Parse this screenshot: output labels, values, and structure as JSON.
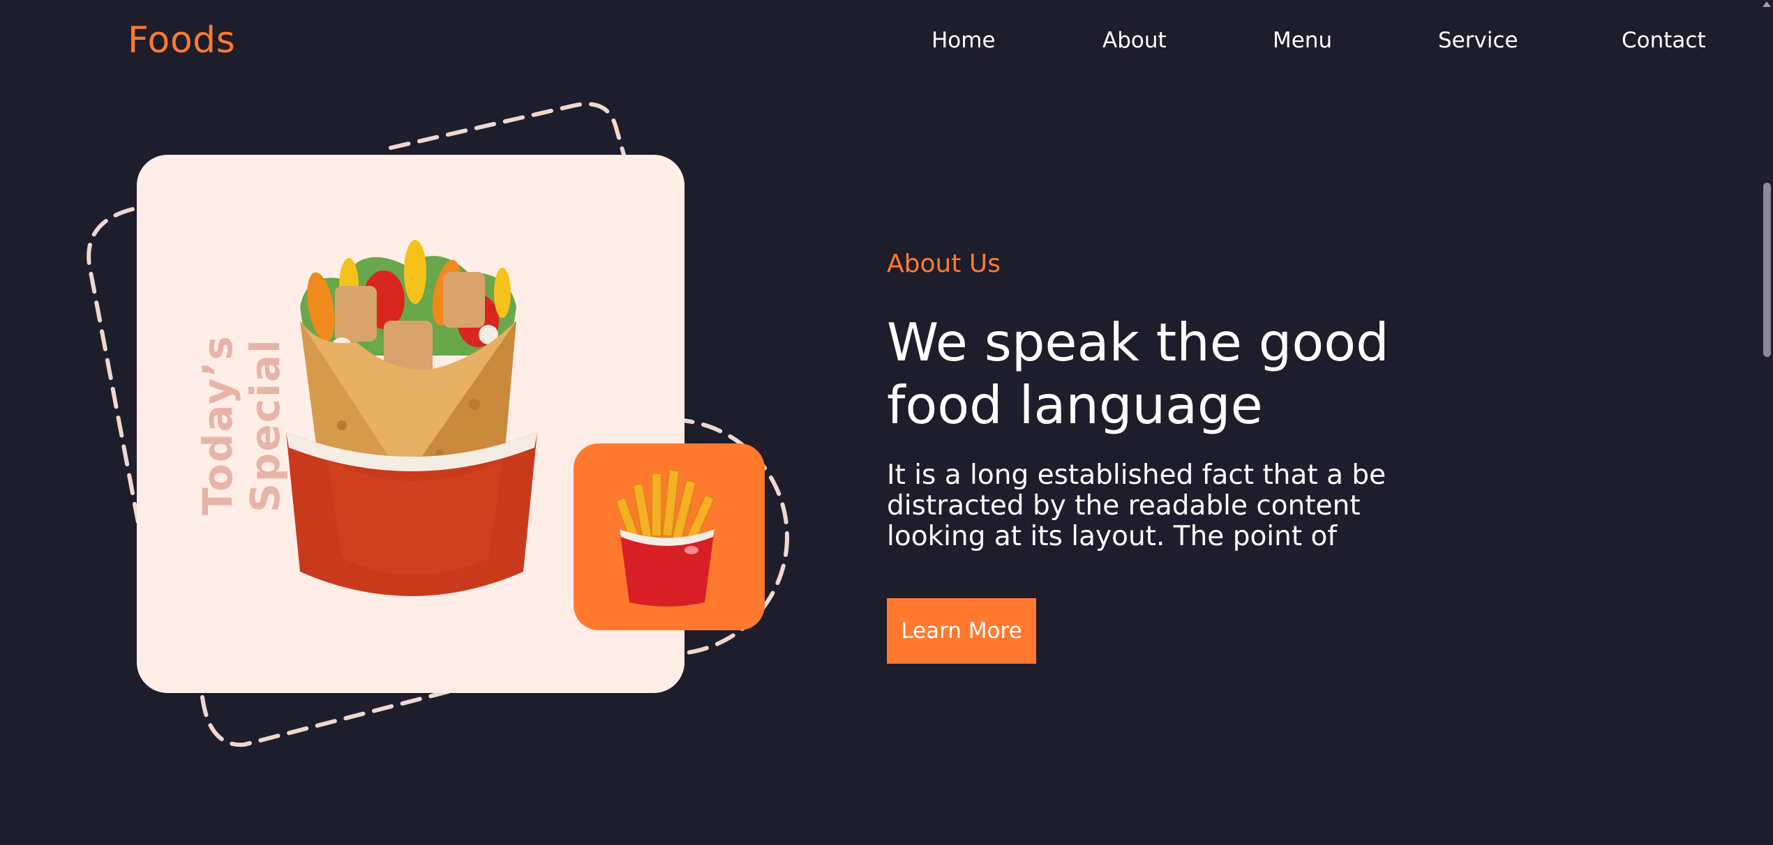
{
  "nav": {
    "logo": "Foods",
    "items": [
      "Home",
      "About",
      "Menu",
      "Service",
      "Contact"
    ]
  },
  "hero": {
    "badge": "Today’s Special",
    "section_label": "About Us",
    "headline": "We speak the good food language",
    "body": "It is a long established fact that a be distracted by the readable content looking at its layout. The point of",
    "button": "Learn More"
  },
  "colors": {
    "background": "#1e1d2b",
    "accent": "#ff7a2f",
    "card": "#ffeee8",
    "text": "#ffffff"
  }
}
